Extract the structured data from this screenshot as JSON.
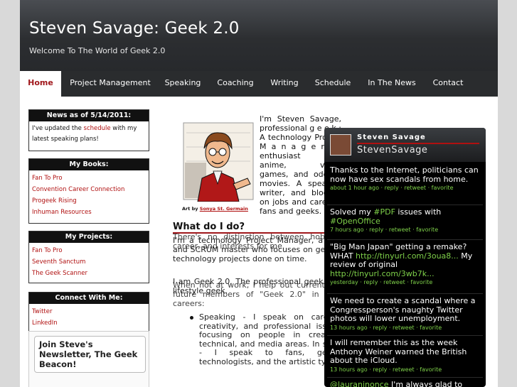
{
  "header": {
    "title": "Steven Savage: Geek 2.0",
    "tagline": "Welcome To The World of Geek 2.0"
  },
  "nav": [
    {
      "label": "Home"
    },
    {
      "label": "Project Management"
    },
    {
      "label": "Speaking"
    },
    {
      "label": "Coaching"
    },
    {
      "label": "Writing"
    },
    {
      "label": "Schedule"
    },
    {
      "label": "In The News"
    },
    {
      "label": "Contact"
    }
  ],
  "sidebar": {
    "news": {
      "title": "News as of 5/14/2011:",
      "text_before": "I've updated the ",
      "link": "schedule",
      "text_after": " with my latest speaking plans!"
    },
    "books": {
      "title": "My Books:",
      "items": [
        "Fan To Pro",
        "Convention Career Connection",
        "Progeek Rising",
        "Inhuman Resources"
      ]
    },
    "projects": {
      "title": "My Projects:",
      "items": [
        "Fan To Pro",
        "Seventh Sanctum",
        "The Geek Scanner"
      ]
    },
    "connect": {
      "title": "Connect With Me:",
      "items": [
        "Twitter",
        "LinkedIn"
      ]
    },
    "newsletter": "Join Steve's Newsletter, The Geek Beacon!"
  },
  "main": {
    "credit_prefix": "Art by ",
    "credit_name": "Sonya St. Germain",
    "intro": "I'm Steven Savage, professional g e e k : A technology Project M a n a g e r. An enthusiast for anime, video games, and odd b-movies. A speaker, writer, and blogger on jobs and careers, fans and geeks.",
    "heading": "What do I do?",
    "para1": "I'm a technology Project Manager, a PMP and SCRUM master who focuses on getting technology projects done on time.",
    "overlap1": "There's no distinction between hobbies, career, and interests for me.",
    "para2": "I am Geek 2.0. The professional geek. The lifestyle geek.",
    "overlap2": "When not at work, I help out current and future members of \"Geek 2.0\" in their careers:",
    "bullet": "Speaking - I speak on careers, creativity, and professional issues, focusing on people in creative, technical, and media areas. In short - I speak to fans, geeks, technologists, and the artistic types."
  },
  "twitter": {
    "name": "Steven Savage",
    "handle": "StevenSavage",
    "tweets": [
      {
        "parts": [
          {
            "t": "Thanks to the Internet, politicians can now have sex scandals from home."
          }
        ],
        "meta": "about 1 hour ago · reply · retweet · favorite"
      },
      {
        "parts": [
          {
            "t": "Solved my "
          },
          {
            "t": "#PDF",
            "link": true
          },
          {
            "t": " issues with "
          },
          {
            "t": "#OpenOffice",
            "link": true
          }
        ],
        "meta": "7 hours ago · reply · retweet · favorite"
      },
      {
        "parts": [
          {
            "t": "\"Big Man Japan\" getting a remake? WHAT "
          },
          {
            "t": "http://tinyurl.com/3oua8...",
            "link": true
          },
          {
            "t": " My review of original "
          },
          {
            "t": "http://tinyurl.com/3wb7k...",
            "link": true
          }
        ],
        "meta": "yesterday · reply · retweet · favorite"
      },
      {
        "parts": [
          {
            "t": "We need to create a scandal where a Congressperson's naughty Twitter photos will lower unemployment."
          }
        ],
        "meta": "13 hours ago · reply · retweet · favorite"
      },
      {
        "parts": [
          {
            "t": "I will remember this as the week Anthony Weiner warned the British about the iCloud."
          }
        ],
        "meta": "13 hours ago · reply · retweet · favorite"
      },
      {
        "parts": [
          {
            "t": "@lauraninonce",
            "link": true
          },
          {
            "t": " I'm always glad to"
          }
        ],
        "meta": ""
      }
    ]
  }
}
